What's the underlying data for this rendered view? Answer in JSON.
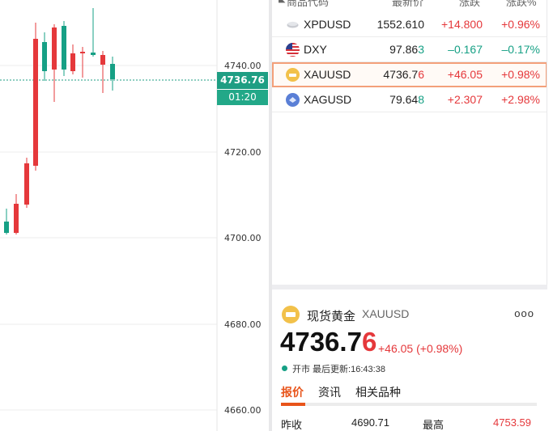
{
  "chart": {
    "y_axis_labels": [
      "4740.00",
      "4720.00",
      "4700.00",
      "4680.00",
      "4660.00"
    ],
    "current_price": "4736.76",
    "countdown": "01:20",
    "colors": {
      "up": "#e5383b",
      "down": "#16a085",
      "price_line": "#1e9e83"
    }
  },
  "watchlist": {
    "columns": [
      "商品代码",
      "最新价",
      "涨跌",
      "涨跌%"
    ],
    "rows": [
      {
        "icon": "silver-bar-icon",
        "symbol": "XPDUSD",
        "last": "1552.610",
        "change": "+14.800",
        "pct": "+0.96%",
        "dir": "up"
      },
      {
        "icon": "us-flag-icon",
        "symbol": "DXY",
        "last_main": "97.86",
        "last_tail": "3",
        "change": "–0.167",
        "pct": "–0.17%",
        "dir": "down"
      },
      {
        "icon": "gold-coin-icon",
        "symbol": "XAUUSD",
        "last_main": "4736.7",
        "last_tail": "6",
        "change": "+46.05",
        "pct": "+0.98%",
        "dir": "up"
      },
      {
        "icon": "silver-coin-icon",
        "symbol": "XAGUSD",
        "last_main": "79.64",
        "last_tail": "8",
        "change": "+2.307",
        "pct": "+2.98%",
        "dir": "up"
      }
    ]
  },
  "detail": {
    "name": "现货黄金",
    "symbol": "XAUUSD",
    "more": "ooo",
    "price_main": "4736.7",
    "price_tail": "6",
    "change": "+46.05 (+0.98%)",
    "status": "开市 最后更新:16:43:38",
    "tabs": [
      "报价",
      "资讯",
      "相关品种"
    ],
    "stats": {
      "prev_close_label": "昨收",
      "prev_close": "4690.71",
      "high_label": "最高",
      "high": "4753.59"
    }
  }
}
